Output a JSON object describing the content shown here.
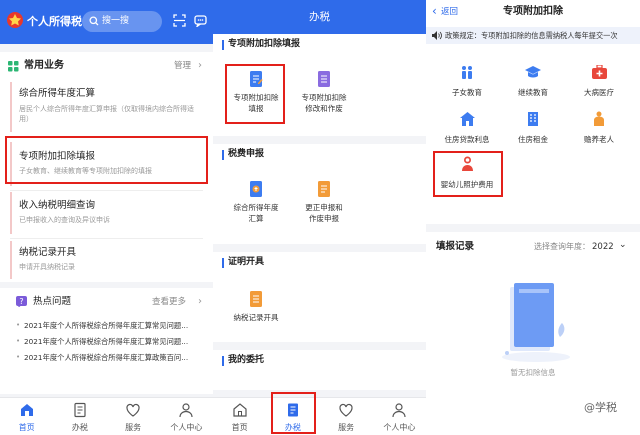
{
  "panel1": {
    "app_title": "个人所得税",
    "search_placeholder": "搜一搜",
    "common_title": "常用业务",
    "manage_label": "管理",
    "items": [
      {
        "title": "综合所得年度汇算",
        "desc": "居民个人综合所得年度汇算申报（仅取得境内综合所得适用）"
      },
      {
        "title": "专项附加扣除填报",
        "desc": "子女教育、继续教育等专项附加扣除的填报"
      },
      {
        "title": "收入纳税明细查询",
        "desc": "已申报收入的查询及异议申诉"
      },
      {
        "title": "纳税记录开具",
        "desc": "申请开具纳税记录"
      }
    ],
    "hot_title": "热点问题",
    "hot_more": "查看更多",
    "hot_list": [
      "2021年度个人所得税综合所得年度汇算常见问题...",
      "2021年度个人所得税综合所得年度汇算常见问题...",
      "2021年度个人所得税综合所得年度汇算政策百问..."
    ]
  },
  "panel2": {
    "title": "办税",
    "sections": [
      {
        "title": "专项附加扣除填报",
        "items": [
          "专项附加扣除\n填报",
          "专项附加扣除\n修改和作废"
        ]
      },
      {
        "title": "税费申报",
        "items": [
          "综合所得年度\n汇算",
          "更正申报和\n作废申报"
        ]
      },
      {
        "title": "证明开具",
        "items": [
          "纳税记录开具"
        ]
      },
      {
        "title": "我的委托",
        "items": []
      }
    ]
  },
  "panel3": {
    "back_label": "返回",
    "title": "专项附加扣除",
    "notice": "政策规定：专项附加扣除的信息需纳税人每年提交一次",
    "grid": [
      "子女教育",
      "继续教育",
      "大病医疗",
      "住房贷款利息",
      "住房租金",
      "赡养老人",
      "婴幼儿照护费用"
    ],
    "records_title": "填报记录",
    "records_filter": "选择查询年度：",
    "records_year": "2022",
    "empty_text": "暂无扣除信息",
    "watermark": "@学税"
  },
  "tabs": [
    "首页",
    "办税",
    "服务",
    "个人中心"
  ],
  "colors": {
    "primary": "#2f6bea",
    "highlight": "#e3201a",
    "orange": "#f29b38"
  }
}
